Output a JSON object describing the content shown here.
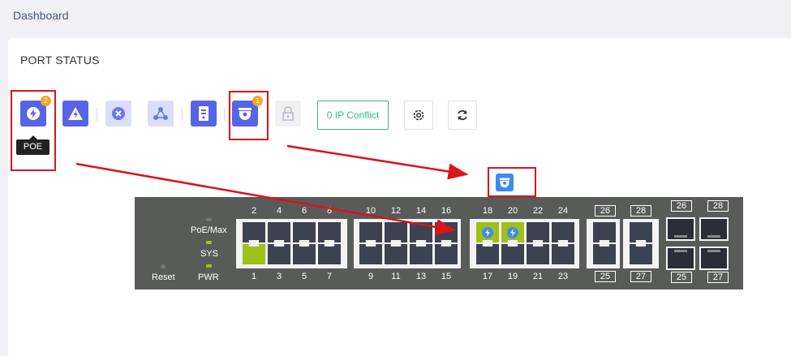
{
  "breadcrumb": "Dashboard",
  "card": {
    "title": "PORT STATUS"
  },
  "toolbar": {
    "poe_badge": "2",
    "camera_badge": "1",
    "tooltip": "POE",
    "ip_conflict": "0 IP Conflict"
  },
  "switch": {
    "labels": {
      "poe_max": "PoE/Max",
      "sys": "SYS",
      "pwr": "PWR",
      "reset": "Reset"
    },
    "top_numbers": [
      "2",
      "4",
      "6",
      "8",
      "10",
      "12",
      "14",
      "16",
      "18",
      "20",
      "22",
      "24"
    ],
    "bottom_numbers": [
      "1",
      "3",
      "5",
      "7",
      "9",
      "11",
      "13",
      "15",
      "17",
      "19",
      "21",
      "23"
    ],
    "combo_numbers": {
      "top": [
        "26",
        "28"
      ],
      "bottom": [
        "25",
        "27"
      ]
    },
    "sfp_numbers": {
      "top": [
        "26",
        "28"
      ],
      "bottom": [
        "25",
        "27"
      ]
    },
    "active_ports": [
      "1"
    ],
    "poe_ports": [
      "18",
      "20"
    ]
  },
  "colors": {
    "accent": "#5864e6",
    "poe": "#9fc018",
    "camera": "#3f89f0",
    "annotation": "#d9141a",
    "ip_conflict": "#3ab77b"
  },
  "icons": [
    "poe-icon",
    "lightning-triangle-icon",
    "close-circle-icon",
    "network-icon",
    "server-icon",
    "camera-icon",
    "lock-icon",
    "gear-icon",
    "refresh-icon"
  ]
}
